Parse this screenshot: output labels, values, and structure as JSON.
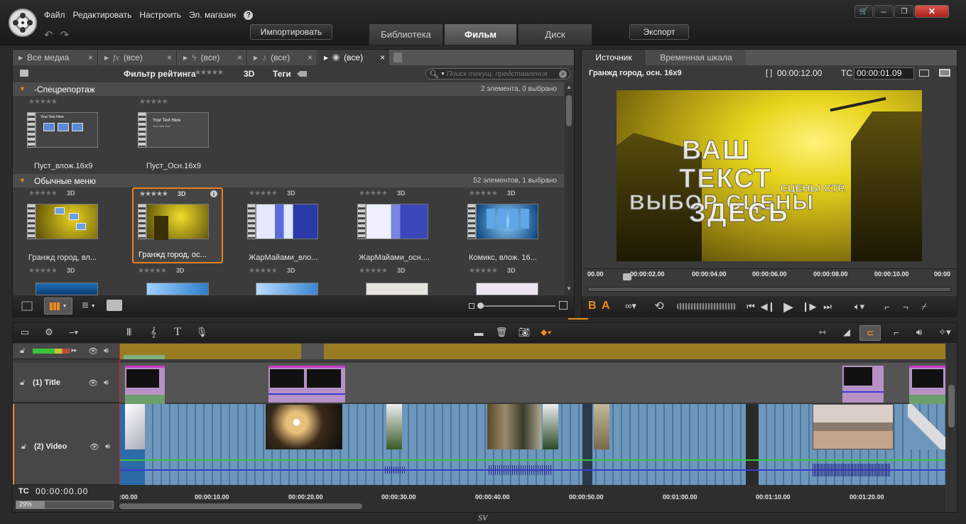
{
  "menubar": {
    "items": [
      "Файл",
      "Редактировать",
      "Настроить",
      "Эл. магазин"
    ],
    "help": "?"
  },
  "toolbar": {
    "import_label": "Импортировать",
    "export_label": "Экспорт",
    "tabs": [
      {
        "label": "Библиотека",
        "active": false
      },
      {
        "label": "Фильм",
        "active": true
      },
      {
        "label": "Диск",
        "active": false
      }
    ]
  },
  "library": {
    "filter_tabs": [
      {
        "label": "Все медиа"
      },
      {
        "label": "(все)",
        "icon": "fx"
      },
      {
        "label": "(все)",
        "icon": "lightning"
      },
      {
        "label": "(все)",
        "icon": "note"
      },
      {
        "label": "(все)",
        "icon": "disc"
      }
    ],
    "rating_filter_label": "Фильтр рейтинга",
    "label_3d": "3D",
    "tags_label": "Теги",
    "search_placeholder": "Поиск текущ. представления",
    "groups": [
      {
        "title": "-Спецрепортаж",
        "count": "2 элемента, 0 выбрано",
        "items": [
          {
            "name": "Пуст_влож.16x9",
            "badge": ""
          },
          {
            "name": "Пуст_Осн.16x9",
            "badge": ""
          }
        ]
      },
      {
        "title": "Обычные меню",
        "count": "52 элементов, 1 выбрано",
        "items": [
          {
            "name": "Гранжд город, вл...",
            "badge": "3D"
          },
          {
            "name": "Гранжд город, ос...",
            "badge": "3D",
            "selected": true
          },
          {
            "name": "ЖарМайами_вло...",
            "badge": "3D"
          },
          {
            "name": "ЖарМайами_осн....",
            "badge": "3D"
          },
          {
            "name": "Комикс, влож. 16...",
            "badge": "3D"
          }
        ]
      }
    ],
    "row3_badges": [
      "3D",
      "3D",
      "3D",
      "3D",
      "3D"
    ],
    "thumb_text": "Your Text Here",
    "thumb_sub": "Your Sub Text"
  },
  "player": {
    "tabs": [
      {
        "label": "Источник",
        "active": true
      },
      {
        "label": "Временная шкала",
        "active": false
      }
    ],
    "clip_name": "Гранжд город, осн. 16x9",
    "duration_prefix": "[ ]",
    "duration": "00:00:12.00",
    "tc_label": "TC",
    "tc_value": "00:00:01.09",
    "preview_lines": [
      "ВАШ",
      "ТЕКСТ",
      "ЗДЕСЬ"
    ],
    "preview_overlay": "ВЫБОР СЦЕНЫ",
    "preview_small": "СЦЕНЫ СТР.",
    "ruler": [
      "00.00",
      "00:00:02.00",
      "00:00:04.00",
      "00:00:06.00",
      "00:00:08.00",
      "00:00:10.00",
      "00:00"
    ],
    "letter_b": "B",
    "letter_a": "A"
  },
  "timeline": {
    "tracks": [
      {
        "name": "(1) Title"
      },
      {
        "name": "(2) Video"
      }
    ],
    "tc_label": "TC",
    "tc_value": "00:00:00.00",
    "zoom": "29%",
    "ruler": [
      ":00.00",
      "00:00:10.00",
      "00:00:20.00",
      "00:00:30.00",
      "00:00:40.00",
      "00:00:50.00",
      "00:01:00.00",
      "00:01:10.00",
      "00:01:20.00"
    ]
  },
  "watermark": "SV",
  "colors": {
    "accent": "#f08a1c",
    "selected_border": "#e8821e",
    "grunge_yellow": "#d6c21a",
    "video_clip": "#6d97bd",
    "title_clip": "#b691c6",
    "audio_level": "#3ac43a"
  }
}
